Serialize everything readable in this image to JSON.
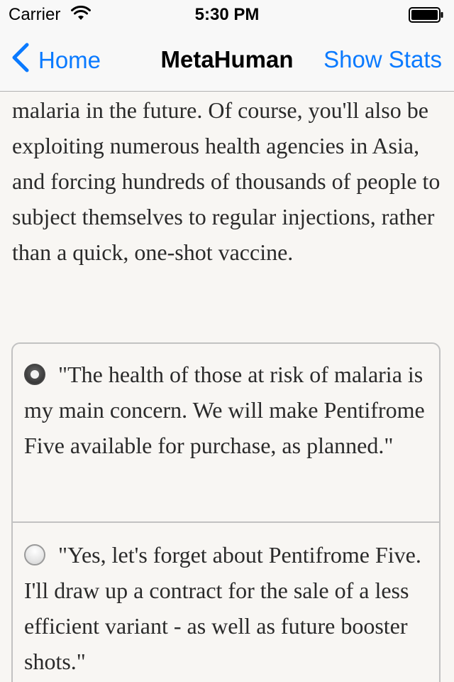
{
  "status_bar": {
    "carrier": "Carrier",
    "time": "5:30 PM",
    "wifi_icon": "wifi-icon",
    "battery_icon": "battery-full-icon"
  },
  "nav": {
    "back_label": "Home",
    "title": "MetaHuman",
    "stats_label": "Show Stats",
    "accent_color": "#0a7aff"
  },
  "story": {
    "text": "malaria in the future. Of course, you'll also be exploiting numerous health agencies in Asia, and forcing hundreds of thousands of people to subject themselves to regular injections, rather than a quick, one-shot vaccine."
  },
  "choices": [
    {
      "text": "\"The health of those at risk of malaria is my main concern. We will make Pentifrome Five available for purchase, as planned.\"",
      "selected": true
    },
    {
      "text": "\"Yes, let's forget about Pentifrome Five. I'll draw up a contract for the sale of a less efficient variant - as well as future booster shots.\"",
      "selected": false
    }
  ]
}
